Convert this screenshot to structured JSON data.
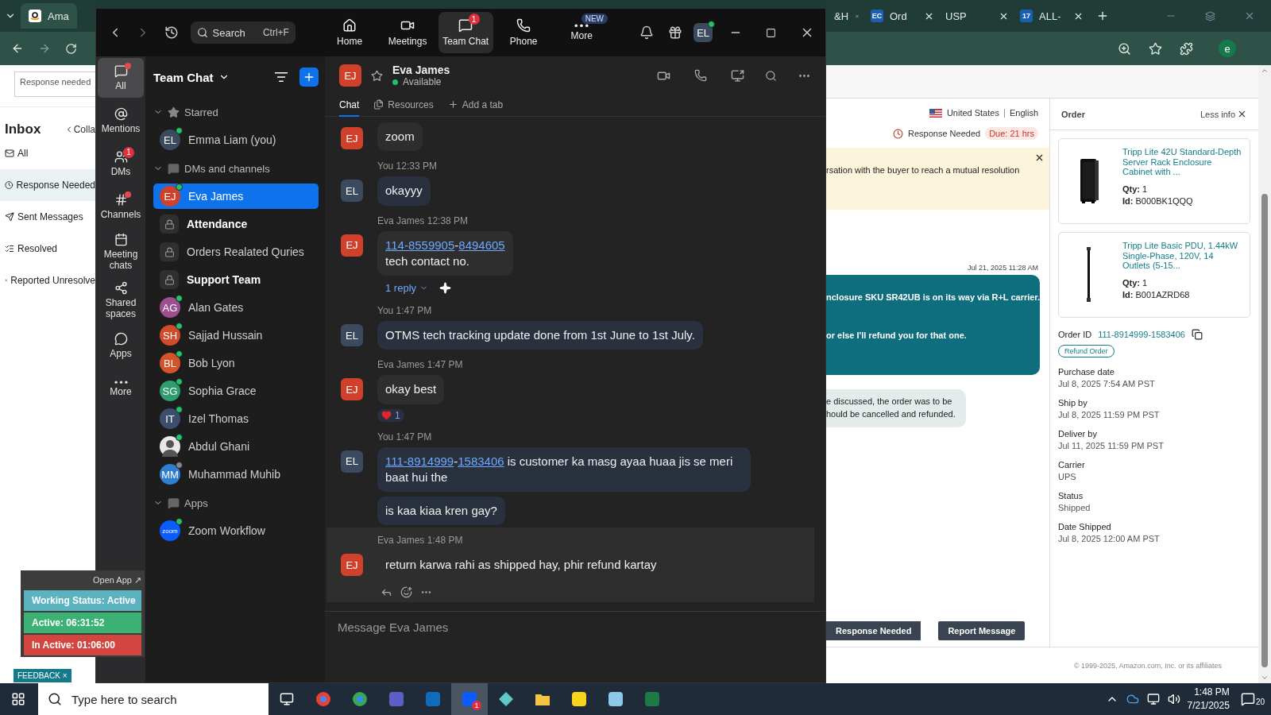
{
  "browser_left": {
    "tab": "Ama",
    "search_value": "Response needed",
    "inbox_title": "Inbox",
    "collapse": "Colla",
    "folders": [
      {
        "label": "All",
        "kind": "all",
        "selected": false
      },
      {
        "label": "Response Needed",
        "kind": "clock",
        "selected": true
      },
      {
        "label": "Sent Messages",
        "kind": "sent",
        "selected": false
      },
      {
        "label": "Resolved",
        "kind": "resolved",
        "selected": false
      },
      {
        "label": "Reported Unresolve",
        "kind": "reported",
        "selected": false
      }
    ]
  },
  "zoom": {
    "toolbar": {
      "search": "Search",
      "shortcut": "Ctrl+F",
      "avatar": "EL",
      "nav": [
        {
          "label": "Home",
          "kind": "home",
          "selected": false
        },
        {
          "label": "Meetings",
          "kind": "meetings",
          "selected": false
        },
        {
          "label": "Team Chat",
          "kind": "chat",
          "selected": true,
          "badge": "1"
        },
        {
          "label": "Phone",
          "kind": "phone",
          "selected": false
        },
        {
          "label": "More",
          "kind": "more",
          "selected": false,
          "tag": "NEW"
        }
      ]
    },
    "rail": [
      {
        "label": "All",
        "kind": "all",
        "selected": true,
        "unread": true
      },
      {
        "label": "Mentions",
        "kind": "mentions",
        "selected": false,
        "unread": false
      },
      {
        "label": "DMs",
        "kind": "dms",
        "selected": false,
        "unread": false,
        "badge": "1"
      },
      {
        "label": "Channels",
        "kind": "channels",
        "selected": false,
        "unread": true
      },
      {
        "label": "Meeting chats",
        "kind": "meetings",
        "selected": false,
        "unread": false
      },
      {
        "label": "Shared spaces",
        "kind": "spaces",
        "selected": false,
        "unread": false
      },
      {
        "label": "Apps",
        "kind": "apps",
        "selected": false,
        "unread": false
      },
      {
        "label": "More",
        "kind": "more",
        "selected": false,
        "unread": false
      }
    ],
    "sidebar": {
      "title": "Team Chat",
      "sections": [
        {
          "title": "Starred",
          "kind": "star",
          "expanded": true,
          "items": [
            {
              "name": "Emma Liam (you)",
              "kind": "person",
              "initials": "EL",
              "color": "#3b4a5e",
              "online": true,
              "selected": false,
              "bold": false
            }
          ]
        },
        {
          "title": "DMs and channels",
          "kind": "chat",
          "expanded": true,
          "items": [
            {
              "name": "Eva James",
              "kind": "person",
              "initials": "EJ",
              "color": "#d0402b",
              "online": true,
              "selected": true,
              "bold": false
            },
            {
              "name": "Attendance",
              "kind": "channel",
              "selected": false,
              "bold": true
            },
            {
              "name": "Orders Realated Quries",
              "kind": "channel",
              "selected": false,
              "bold": false
            },
            {
              "name": "Support Team",
              "kind": "channel",
              "selected": false,
              "bold": true
            },
            {
              "name": "Alan Gates",
              "kind": "person",
              "initials": "AG",
              "color": "#9b4f8f",
              "online": true,
              "selected": false,
              "bold": false
            },
            {
              "name": "Sajjad Hussain",
              "kind": "person",
              "initials": "SH",
              "color": "#d24b2a",
              "online": true,
              "selected": false,
              "bold": false
            },
            {
              "name": "Bob Lyon",
              "kind": "person",
              "initials": "BL",
              "color": "#d4532b",
              "online": true,
              "selected": false,
              "bold": false
            },
            {
              "name": "Sophia Grace",
              "kind": "person",
              "initials": "SG",
              "color": "#2f9e6e",
              "online": true,
              "selected": false,
              "bold": false
            },
            {
              "name": "Izel Thomas",
              "kind": "person",
              "initials": "IT",
              "color": "#3c4e6b",
              "online": true,
              "selected": false,
              "bold": false
            },
            {
              "name": "Abdul Ghani",
              "online": true,
              "selected": false,
              "bold": false
            },
            {
              "name": "Muhammad Muhib",
              "kind": "person",
              "initials": "MM",
              "color": "#2f7fd1",
              "online": false,
              "selected": false,
              "bold": false
            }
          ]
        },
        {
          "title": "Apps",
          "kind": "chat",
          "expanded": true,
          "items": [
            {
              "name": "Zoom Workflow",
              "kind": "app",
              "logo": "zoom",
              "online": true,
              "selected": false,
              "bold": false
            }
          ]
        }
      ]
    },
    "chat": {
      "name": "Eva James",
      "initials": "EJ",
      "status": "Available",
      "tabs": [
        {
          "label": "Chat",
          "kind": "chat",
          "selected": true
        },
        {
          "label": "Resources",
          "kind": "files",
          "selected": false
        },
        {
          "label": "Add a tab",
          "kind": "add",
          "selected": false
        }
      ],
      "messages": [
        {
          "initials": "EJ",
          "color": "#d0402b",
          "mine": false,
          "hovered": false,
          "bubbles": [
            [
              [
                {
                  "text": "zoom",
                  "link": false
                }
              ]
            ]
          ]
        },
        {
          "initials": "EL",
          "color": "#3b4a5e",
          "mine": true,
          "hovered": false,
          "author": "You",
          "time": "12:33 PM",
          "bubbles": [
            [
              [
                {
                  "text": "okayyy",
                  "link": false
                }
              ]
            ]
          ]
        },
        {
          "initials": "EJ",
          "color": "#d0402b",
          "mine": false,
          "hovered": false,
          "author": "Eva James",
          "time": "12:38 PM",
          "bubbles": [
            [
              [
                {
                  "text": "114-8559905",
                  "link": true
                },
                {
                  "text": "-",
                  "link": false
                },
                {
                  "text": "8494605",
                  "link": true
                }
              ],
              [
                {
                  "text": "tech contact no.",
                  "link": false
                }
              ]
            ]
          ],
          "replies": "1 reply"
        },
        {
          "initials": "EL",
          "color": "#3b4a5e",
          "mine": true,
          "hovered": false,
          "author": "You",
          "time": "1:47 PM",
          "bubbles": [
            [
              [
                {
                  "text": "OTMS tech tracking update done from 1st June to 1st July.",
                  "link": false
                }
              ]
            ]
          ]
        },
        {
          "initials": "EJ",
          "color": "#d0402b",
          "mine": false,
          "hovered": false,
          "author": "Eva James",
          "time": "1:47 PM",
          "bubbles": [
            [
              [
                {
                  "text": "okay best",
                  "link": false
                }
              ]
            ]
          ],
          "reaction": "1"
        },
        {
          "initials": "EL",
          "color": "#3b4a5e",
          "mine": true,
          "hovered": false,
          "author": "You",
          "time": "1:47 PM",
          "bubbles": [
            [
              [
                {
                  "text": "111-8914999",
                  "link": true
                },
                {
                  "text": "-",
                  "link": false
                },
                {
                  "text": "1583406",
                  "link": true
                },
                {
                  "text": " is customer ka masg ayaa huaa jis se meri baat hui the",
                  "link": false
                }
              ]
            ],
            [
              [
                {
                  "text": "is kaa kiaa kren gay?",
                  "link": false
                }
              ]
            ]
          ]
        },
        {
          "initials": "EJ",
          "color": "#d0402b",
          "mine": false,
          "hovered": true,
          "author": "Eva James",
          "time": "1:48 PM",
          "bubbles": [
            [
              [
                {
                  "text": "return karwa rahi as shipped hay, phir refund kartay",
                  "link": false
                }
              ]
            ]
          ]
        }
      ],
      "composer": {
        "placeholder": "Message Eva James"
      }
    },
    "widget": {
      "open_app": "Open App ↗",
      "rows": [
        {
          "text": "Working Status: Active",
          "color": "#5bb3c0"
        },
        {
          "text": "Active: 06:31:52",
          "color": "#3bb273"
        },
        {
          "text": "In Active: 01:06:00",
          "color": "#d2463f"
        }
      ],
      "feedback": "FEEDBACK ×"
    }
  },
  "browser_right": {
    "tabs": [
      {
        "label": "&H"
      },
      {
        "label": "Ord",
        "favicon": "EC"
      },
      {
        "label": "USP"
      },
      {
        "label": "ALL-",
        "favicon": "17"
      }
    ],
    "profile": "e",
    "marketplace": "United States",
    "language": "English",
    "status": "Response Needed",
    "due": "Due: 21 hrs",
    "banner": "rsation with the buyer to reach a mutual resolution",
    "timestamp": "Jul 21, 2025 11:28 AM",
    "seller_lines": [
      "nclosure SKU SR42UB is on its way via R+L carrier.",
      "or else I'll refund you for that one."
    ],
    "buyer_lines": [
      "e discussed, the order was to be",
      "hould be cancelled and refunded."
    ],
    "buttons": [
      "Response Needed",
      "Report Message"
    ],
    "footer": "© 1999-2025, Amazon.com, Inc. or its affiliates",
    "order": {
      "title": "Order",
      "less_info": "Less info",
      "products": [
        {
          "title": "Tripp Lite 42U Standard-Depth Server Rack Enclosure Cabinet with ...",
          "kind": "rack",
          "qty_label": "Qty:",
          "qty": "1",
          "id_label": "Id:",
          "id": "B000BK1QQQ"
        },
        {
          "title": "Tripp Lite Basic PDU, 1.44kW Single-Phase, 120V, 14 Outlets (5-15...",
          "kind": "strip",
          "qty_label": "Qty:",
          "qty": "1",
          "id_label": "Id:",
          "id": "B001AZRD68"
        }
      ],
      "order_id_label": "Order ID",
      "order_id": "111-8914999-1583406",
      "refund": "Refund Order",
      "fields": [
        {
          "label": "Purchase date",
          "value": "Jul 8, 2025 7:54 AM PST"
        },
        {
          "label": "Ship by",
          "value": "Jul 8, 2025 11:59 PM PST"
        },
        {
          "label": "Deliver by",
          "value": "Jul 11, 2025 11:59 PM PST"
        },
        {
          "label": "Carrier",
          "value": "UPS"
        },
        {
          "label": "Status",
          "value": "Shipped"
        },
        {
          "label": "Date Shipped",
          "value": "Jul 8, 2025 12:00 AM PST"
        }
      ]
    }
  },
  "taskbar": {
    "search": "Type here to search",
    "time": "1:48 PM",
    "date": "7/21/2025",
    "notifications": "20",
    "zoom_badge": "1"
  }
}
